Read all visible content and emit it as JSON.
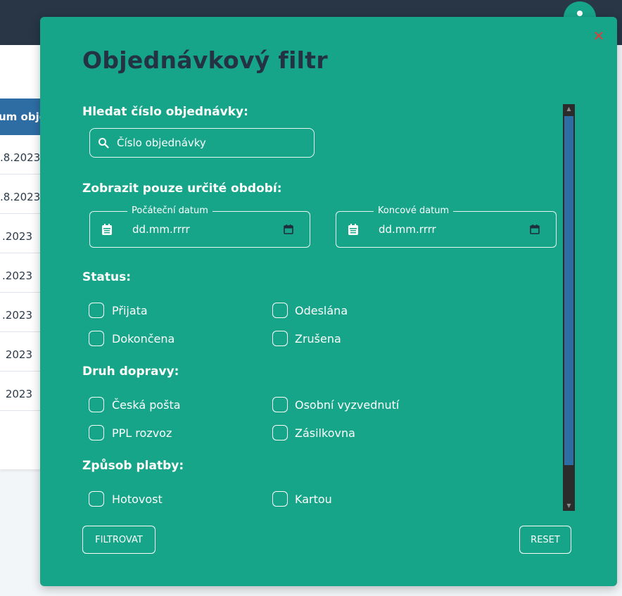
{
  "background": {
    "table_header": "um obje",
    "rows": [
      ".8.2023",
      ".8.2023",
      ".2023",
      ".2023",
      ".2023",
      "2023",
      "2023"
    ]
  },
  "modal": {
    "title": "Objednávkový filtr",
    "close_icon": "close-x-icon",
    "search": {
      "label": "Hledat číslo objednávky:",
      "placeholder": "Číslo objednávky",
      "icon": "search-icon"
    },
    "period": {
      "label": "Zobrazit pouze určité období:",
      "start_legend": "Počáteční datum",
      "start_value": "dd.mm.rrrr",
      "end_legend": "Koncové datum",
      "end_value": "dd.mm.rrrr"
    },
    "status": {
      "label": "Status:",
      "options": [
        "Přijata",
        "Odeslána",
        "Dokončena",
        "Zrušena"
      ]
    },
    "shipping": {
      "label": "Druh dopravy:",
      "options": [
        "Česká pošta",
        "Osobní vyzvednutí",
        "PPL rozvoz",
        "Zásilkovna"
      ]
    },
    "payment": {
      "label": "Způsob platby:",
      "options": [
        "Hotovost",
        "Kartou"
      ]
    },
    "buttons": {
      "filter": "FILTROVAT",
      "reset": "RESET"
    }
  },
  "colors": {
    "modal_bg": "#17a589",
    "topbar": "#283645",
    "accent_blue": "#2e6da4",
    "close": "#e03c3c",
    "title": "#233343"
  }
}
